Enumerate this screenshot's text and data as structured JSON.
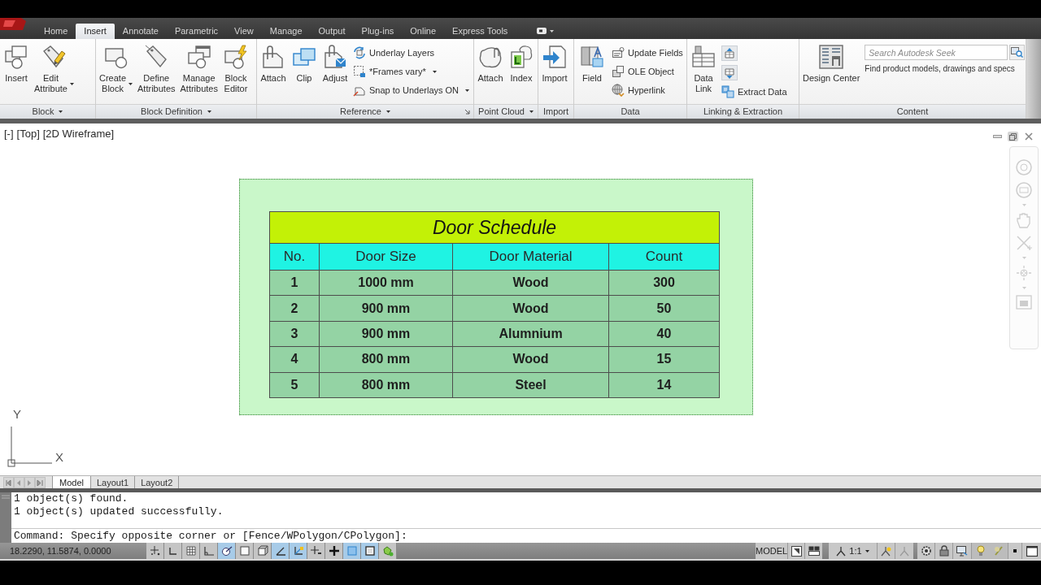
{
  "ribbon": {
    "tabs": [
      {
        "label": "Home",
        "selected": false
      },
      {
        "label": "Insert",
        "selected": true
      },
      {
        "label": "Annotate",
        "selected": false
      },
      {
        "label": "Parametric",
        "selected": false
      },
      {
        "label": "View",
        "selected": false
      },
      {
        "label": "Manage",
        "selected": false
      },
      {
        "label": "Output",
        "selected": false
      },
      {
        "label": "Plug-ins",
        "selected": false
      },
      {
        "label": "Online",
        "selected": false
      },
      {
        "label": "Express Tools",
        "selected": false
      }
    ],
    "panels": [
      {
        "title": "Block",
        "menu": true,
        "launcher": false,
        "items": [
          {
            "kind": "large",
            "lines": [
              "Insert"
            ],
            "dropdown": false
          },
          {
            "kind": "large",
            "lines": [
              "Edit",
              "Attribute"
            ],
            "dropdown": true
          }
        ]
      },
      {
        "title": "Block Definition",
        "menu": true,
        "launcher": false,
        "items": [
          {
            "kind": "large",
            "lines": [
              "Create",
              "Block"
            ],
            "dropdown": true
          },
          {
            "kind": "large",
            "lines": [
              "Define",
              "Attributes"
            ],
            "dropdown": false
          },
          {
            "kind": "large",
            "lines": [
              "Manage",
              "Attributes"
            ],
            "dropdown": false
          },
          {
            "kind": "large",
            "lines": [
              "Block",
              "Editor"
            ],
            "dropdown": false
          }
        ]
      },
      {
        "title": "Reference",
        "menu": true,
        "launcher": true,
        "items": [
          {
            "kind": "large",
            "lines": [
              "Attach"
            ],
            "dropdown": false
          },
          {
            "kind": "large",
            "lines": [
              "Clip"
            ],
            "dropdown": false
          },
          {
            "kind": "large",
            "lines": [
              "Adjust"
            ],
            "dropdown": false
          },
          {
            "kind": "small",
            "label": "Underlay Layers",
            "dropdown": false
          },
          {
            "kind": "small",
            "label": "*Frames vary*",
            "dropdown": true
          },
          {
            "kind": "small",
            "label": "Snap to Underlays ON",
            "dropdown": true
          }
        ]
      },
      {
        "title": "Point Cloud",
        "menu": true,
        "launcher": false,
        "items": [
          {
            "kind": "large",
            "lines": [
              "Attach"
            ],
            "dropdown": false
          },
          {
            "kind": "large",
            "lines": [
              "Index"
            ],
            "dropdown": false
          }
        ]
      },
      {
        "title": "Import",
        "menu": false,
        "launcher": false,
        "items": [
          {
            "kind": "large",
            "lines": [
              "Import"
            ],
            "dropdown": false
          }
        ]
      },
      {
        "title": "Data",
        "menu": false,
        "launcher": false,
        "items": [
          {
            "kind": "large",
            "lines": [
              "Field"
            ],
            "dropdown": false
          },
          {
            "kind": "small",
            "label": "Update Fields",
            "dropdown": false
          },
          {
            "kind": "small",
            "label": "OLE Object",
            "dropdown": false
          },
          {
            "kind": "small",
            "label": "Hyperlink",
            "dropdown": false
          }
        ]
      },
      {
        "title": "Linking & Extraction",
        "menu": false,
        "launcher": false,
        "items": [
          {
            "kind": "large",
            "lines": [
              "Data",
              "Link"
            ],
            "dropdown": false
          },
          {
            "kind": "icon"
          },
          {
            "kind": "icon"
          },
          {
            "kind": "small",
            "label": "Extract Data",
            "dropdown": false
          }
        ]
      },
      {
        "title": "Content",
        "menu": false,
        "launcher": false,
        "items": [
          {
            "kind": "large",
            "lines": [
              "Design Center"
            ],
            "dropdown": false
          }
        ],
        "search": {
          "placeholder": "Search Autodesk Seek"
        },
        "note": "Find product models, drawings and specs"
      }
    ]
  },
  "viewport": {
    "controls": [
      "[-]",
      "[Top]",
      "[2D Wireframe]"
    ],
    "table": {
      "title": "Door Schedule",
      "columns": [
        "No.",
        "Door Size",
        "Door Material",
        "Count"
      ],
      "rows": [
        [
          "1",
          "1000 mm",
          "Wood",
          "300"
        ],
        [
          "2",
          "900 mm",
          "Wood",
          "50"
        ],
        [
          "3",
          "900 mm",
          "Alumnium",
          "40"
        ],
        [
          "4",
          "800 mm",
          "Wood",
          "15"
        ],
        [
          "5",
          "800 mm",
          "Steel",
          "14"
        ]
      ]
    },
    "ucs": {
      "y": "Y",
      "x": "X"
    }
  },
  "layout_tabs": [
    {
      "label": "Model",
      "selected": true
    },
    {
      "label": "Layout1",
      "selected": false
    },
    {
      "label": "Layout2",
      "selected": false
    }
  ],
  "command_line": {
    "history": [
      "1 object(s) found.",
      "1 object(s) updated successfully."
    ],
    "prompt": "Command: Specify opposite corner or [Fence/WPolygon/CPolygon]:"
  },
  "status_bar": {
    "coordinates": "18.2290, 11.5874, 0.0000",
    "toggles": [
      {
        "on": false
      },
      {
        "on": false
      },
      {
        "on": false
      },
      {
        "on": false
      },
      {
        "on": true
      },
      {
        "on": false
      },
      {
        "on": false
      },
      {
        "on": true
      },
      {
        "on": true
      },
      {
        "on": false
      },
      {
        "on": false
      },
      {
        "on": true
      },
      {
        "on": true
      },
      {
        "on": false
      }
    ],
    "space": "MODEL",
    "annotation_scale": "1:1"
  }
}
